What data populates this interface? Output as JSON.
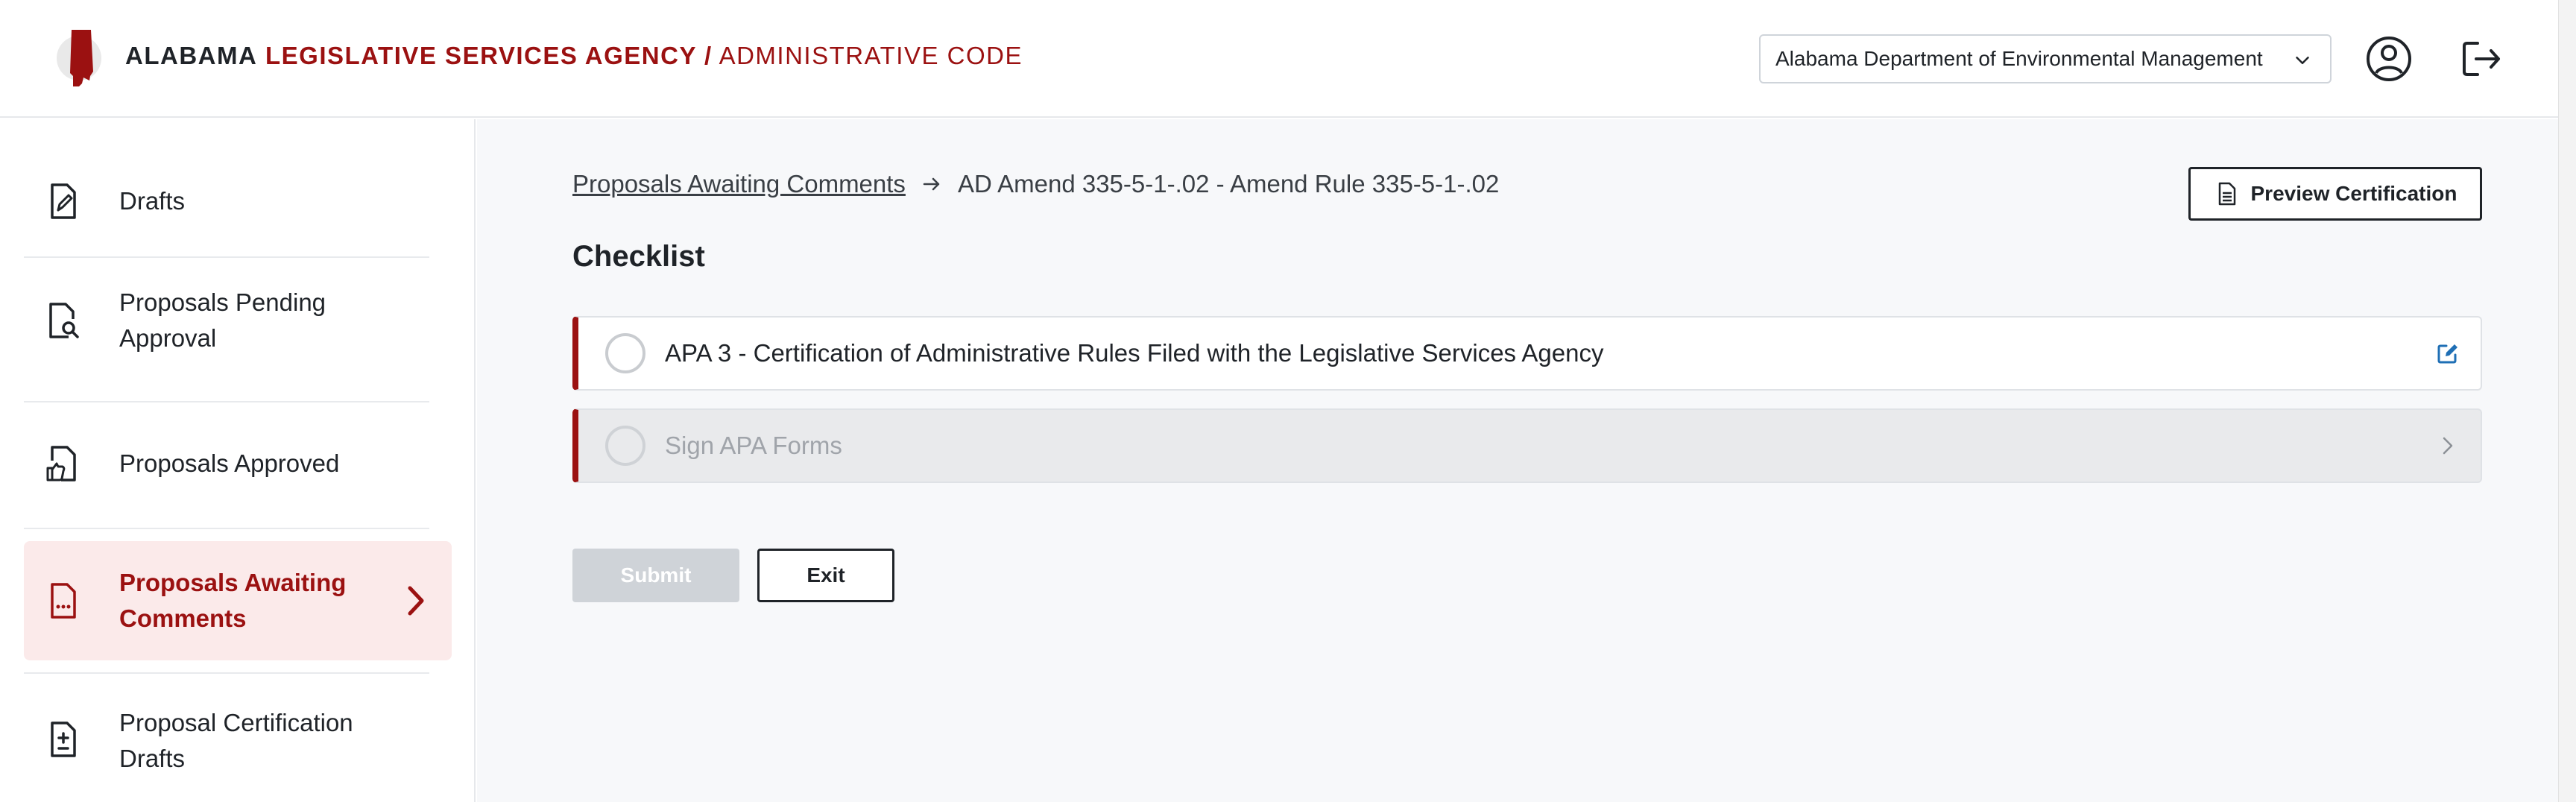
{
  "header": {
    "brand_part1": "ALABAMA",
    "brand_part2": "LEGISLATIVE SERVICES AGENCY /",
    "brand_part3": "ADMINISTRATIVE CODE",
    "department_selected": "Alabama Department of Environmental Management",
    "icons": [
      "alabama-state-logo",
      "chevron-down-icon",
      "user-circle-icon",
      "logout-icon"
    ]
  },
  "sidebar": {
    "items": [
      {
        "label": "Drafts",
        "icon": "document-edit-icon"
      },
      {
        "label": "Proposals Pending Approval",
        "icon": "document-search-icon"
      },
      {
        "label": "Proposals Approved",
        "icon": "document-thumbs-up-icon"
      },
      {
        "label": "Proposals Awaiting Comments",
        "icon": "document-comment-icon",
        "active": true
      },
      {
        "label": "Proposal Certification Drafts",
        "icon": "document-plus-minus-icon"
      }
    ]
  },
  "main": {
    "breadcrumb": {
      "link": "Proposals Awaiting Comments",
      "current": "AD Amend 335-5-1-.02 - Amend Rule 335-5-1-.02"
    },
    "preview_button": "Preview Certification",
    "section_title": "Checklist",
    "checklist": [
      {
        "label": "APA 3 - Certification of Administrative Rules Filed with the Legislative Services Agency",
        "action_icon": "edit-icon",
        "enabled": true
      },
      {
        "label": "Sign APA Forms",
        "action_icon": "chevron-right-icon",
        "enabled": false
      }
    ],
    "submit_label": "Submit",
    "exit_label": "Exit"
  },
  "colors": {
    "brand_red": "#9b1111",
    "active_bg": "#fbeaea",
    "edit_icon_blue": "#1f6fb5",
    "disabled_button": "#cfd3d8"
  }
}
